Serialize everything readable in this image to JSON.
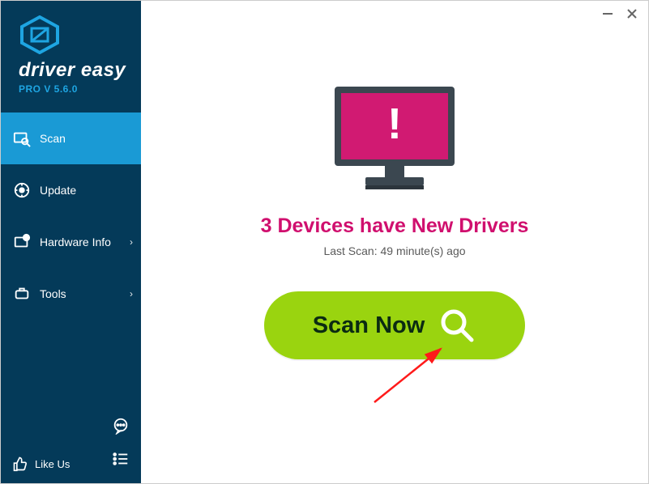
{
  "app": {
    "brand": "driver easy",
    "version_label": "PRO V 5.6.0"
  },
  "sidebar": {
    "items": [
      {
        "label": "Scan",
        "active": true
      },
      {
        "label": "Update",
        "active": false
      },
      {
        "label": "Hardware Info",
        "active": false
      },
      {
        "label": "Tools",
        "active": false
      }
    ],
    "likeus_label": "Like Us"
  },
  "main": {
    "heading": "3 Devices have New Drivers",
    "last_scan": "Last Scan: 49 minute(s) ago",
    "scan_button_label": "Scan Now"
  },
  "colors": {
    "sidebar_bg": "#043a59",
    "sidebar_active": "#1a9ad5",
    "accent_pink": "#d00f6e",
    "scan_green": "#9ad40f",
    "monitor_pink": "#d11a72"
  }
}
